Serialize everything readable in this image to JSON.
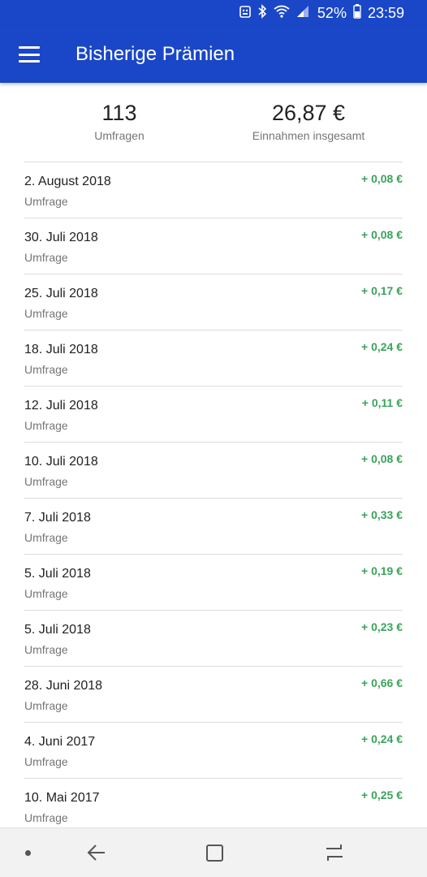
{
  "status_bar": {
    "battery_percent": "52%",
    "time": "23:59",
    "icons": [
      "notification-icon",
      "bluetooth-icon",
      "wifi-icon",
      "signal-icon",
      "battery-icon"
    ]
  },
  "app_bar": {
    "title": "Bisherige Prämien",
    "menu_icon": "hamburger-menu-icon"
  },
  "summary": {
    "surveys_count": "113",
    "surveys_label": "Umfragen",
    "total_earnings": "26,87 €",
    "total_label": "Einnahmen insgesamt"
  },
  "rewards": [
    {
      "date": "2. August 2018",
      "type": "Umfrage",
      "amount": "+ 0,08 €"
    },
    {
      "date": "30. Juli 2018",
      "type": "Umfrage",
      "amount": "+ 0,08 €"
    },
    {
      "date": "25. Juli 2018",
      "type": "Umfrage",
      "amount": "+ 0,17 €"
    },
    {
      "date": "18. Juli 2018",
      "type": "Umfrage",
      "amount": "+ 0,24 €"
    },
    {
      "date": "12. Juli 2018",
      "type": "Umfrage",
      "amount": "+ 0,11 €"
    },
    {
      "date": "10. Juli 2018",
      "type": "Umfrage",
      "amount": "+ 0,08 €"
    },
    {
      "date": "7. Juli 2018",
      "type": "Umfrage",
      "amount": "+ 0,33 €"
    },
    {
      "date": "5. Juli 2018",
      "type": "Umfrage",
      "amount": "+ 0,19 €"
    },
    {
      "date": "5. Juli 2018",
      "type": "Umfrage",
      "amount": "+ 0,23 €"
    },
    {
      "date": "28. Juni 2018",
      "type": "Umfrage",
      "amount": "+ 0,66 €"
    },
    {
      "date": "4. Juni 2017",
      "type": "Umfrage",
      "amount": "+ 0,24 €"
    },
    {
      "date": "10. Mai 2017",
      "type": "Umfrage",
      "amount": "+ 0,25 €"
    }
  ],
  "colors": {
    "primary": "#1a47c7",
    "amount_green": "#3aa35a"
  },
  "nav_bar": {
    "icons": [
      "dot-icon",
      "back-icon",
      "home-icon",
      "recent-apps-icon"
    ]
  }
}
